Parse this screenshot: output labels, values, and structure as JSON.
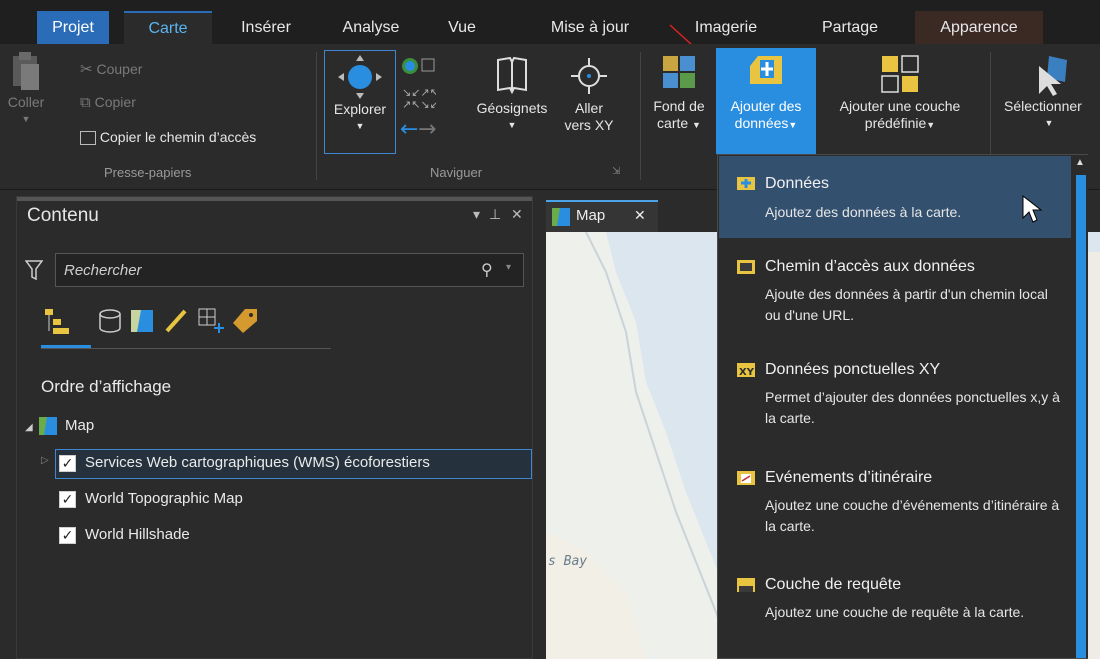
{
  "tabs": [
    "Projet",
    "Carte",
    "Insérer",
    "Analyse",
    "Vue",
    "Mise à jour",
    "Imagerie",
    "Partage",
    "Apparence"
  ],
  "ribbon": {
    "coller": "Coller",
    "couper": "Couper",
    "copier": "Copier",
    "copier_chemin": "Copier le chemin d’accès",
    "presse_papiers": "Presse-papiers",
    "explorer": "Explorer",
    "geosignets": "Géosignets",
    "aller_line1": "Aller",
    "aller_line2": "vers XY",
    "naviguer": "Naviguer",
    "fond_line1": "Fond de",
    "fond_line2": "carte",
    "ajouter_line1": "Ajouter des",
    "ajouter_line2": "données",
    "predef_line1": "Ajouter une couche",
    "predef_line2": "prédéfinie",
    "selectionner": "Sélectionner"
  },
  "contents": {
    "title": "Contenu",
    "search_placeholder": "Rechercher",
    "section_title": "Ordre d’affichage",
    "map_label": "Map",
    "layers": [
      "Services Web cartographiques (WMS) écoforestiers",
      "World Topographic Map",
      "World Hillshade"
    ]
  },
  "map": {
    "tab_label": "Map",
    "map_text": "s Bay"
  },
  "dropdown": {
    "items": [
      {
        "title": "Données",
        "desc": "Ajoutez des données à la carte."
      },
      {
        "title": "Chemin d’accès aux données",
        "desc": "Ajoute des données à partir d'un chemin local ou d'une URL."
      },
      {
        "title": "Données ponctuelles XY",
        "desc": "Permet d’ajouter des données ponctuelles x,y à la carte."
      },
      {
        "title": "Evénements d’itinéraire",
        "desc": "Ajoutez une couche d’événements d’itinéraire à la carte."
      },
      {
        "title": "Couche de requête",
        "desc": "Ajoutez une couche de requête à la carte."
      }
    ]
  },
  "colors": {
    "accent": "#2a8ee0",
    "projet_tab": "#2a6cb8",
    "highlight": "#33506f"
  }
}
